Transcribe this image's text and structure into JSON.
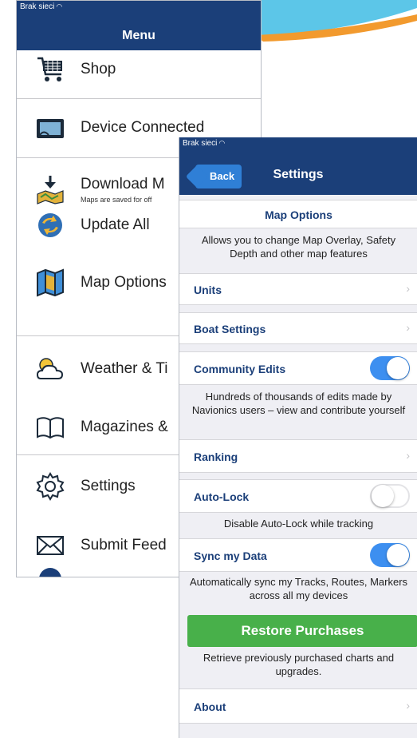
{
  "colors": {
    "nav_bar": "#1b3f79",
    "accent_blue": "#3d8ff0",
    "back_button": "#2f7fd6",
    "restore_green": "#48b04a",
    "row_title": "#1b3f79"
  },
  "menu_screen": {
    "status": {
      "network": "Brak sieci",
      "icon": "wifi-icon"
    },
    "title": "Menu",
    "items": [
      {
        "label": "Shop",
        "icon": "cart-icon"
      },
      {
        "label": "Device Connected",
        "icon": "device-screen-icon"
      },
      {
        "label": "Download M",
        "sub": "Maps are saved for off",
        "icon": "download-map-icon"
      },
      {
        "label": "Update All",
        "icon": "refresh-globe-icon"
      },
      {
        "label": "Map Options",
        "icon": "map-icon"
      },
      {
        "label": "Weather & Ti",
        "icon": "weather-icon"
      },
      {
        "label": "Magazines &",
        "icon": "book-icon"
      },
      {
        "label": "Settings",
        "icon": "gear-icon"
      },
      {
        "label": "Submit Feed",
        "icon": "envelope-icon"
      }
    ]
  },
  "settings_screen": {
    "status": {
      "network": "Brak sieci",
      "icon": "wifi-icon"
    },
    "back_label": "Back",
    "title": "Settings",
    "map_options": {
      "title": "Map Options",
      "description": "Allows you to change Map Overlay, Safety Depth and other map features"
    },
    "units": "Units",
    "boat_settings": "Boat Settings",
    "community_edits": {
      "label": "Community Edits",
      "enabled": true,
      "description": "Hundreds of thousands of edits made by Navionics users – view and contribute yourself"
    },
    "ranking": "Ranking",
    "auto_lock": {
      "label": "Auto-Lock",
      "enabled": false,
      "description": "Disable Auto-Lock while tracking"
    },
    "sync": {
      "label": "Sync my Data",
      "enabled": true,
      "description": "Automatically sync my Tracks, Routes, Markers across all my devices"
    },
    "restore": {
      "label": "Restore Purchases",
      "description": "Retrieve previously purchased charts and upgrades."
    },
    "about": "About"
  }
}
